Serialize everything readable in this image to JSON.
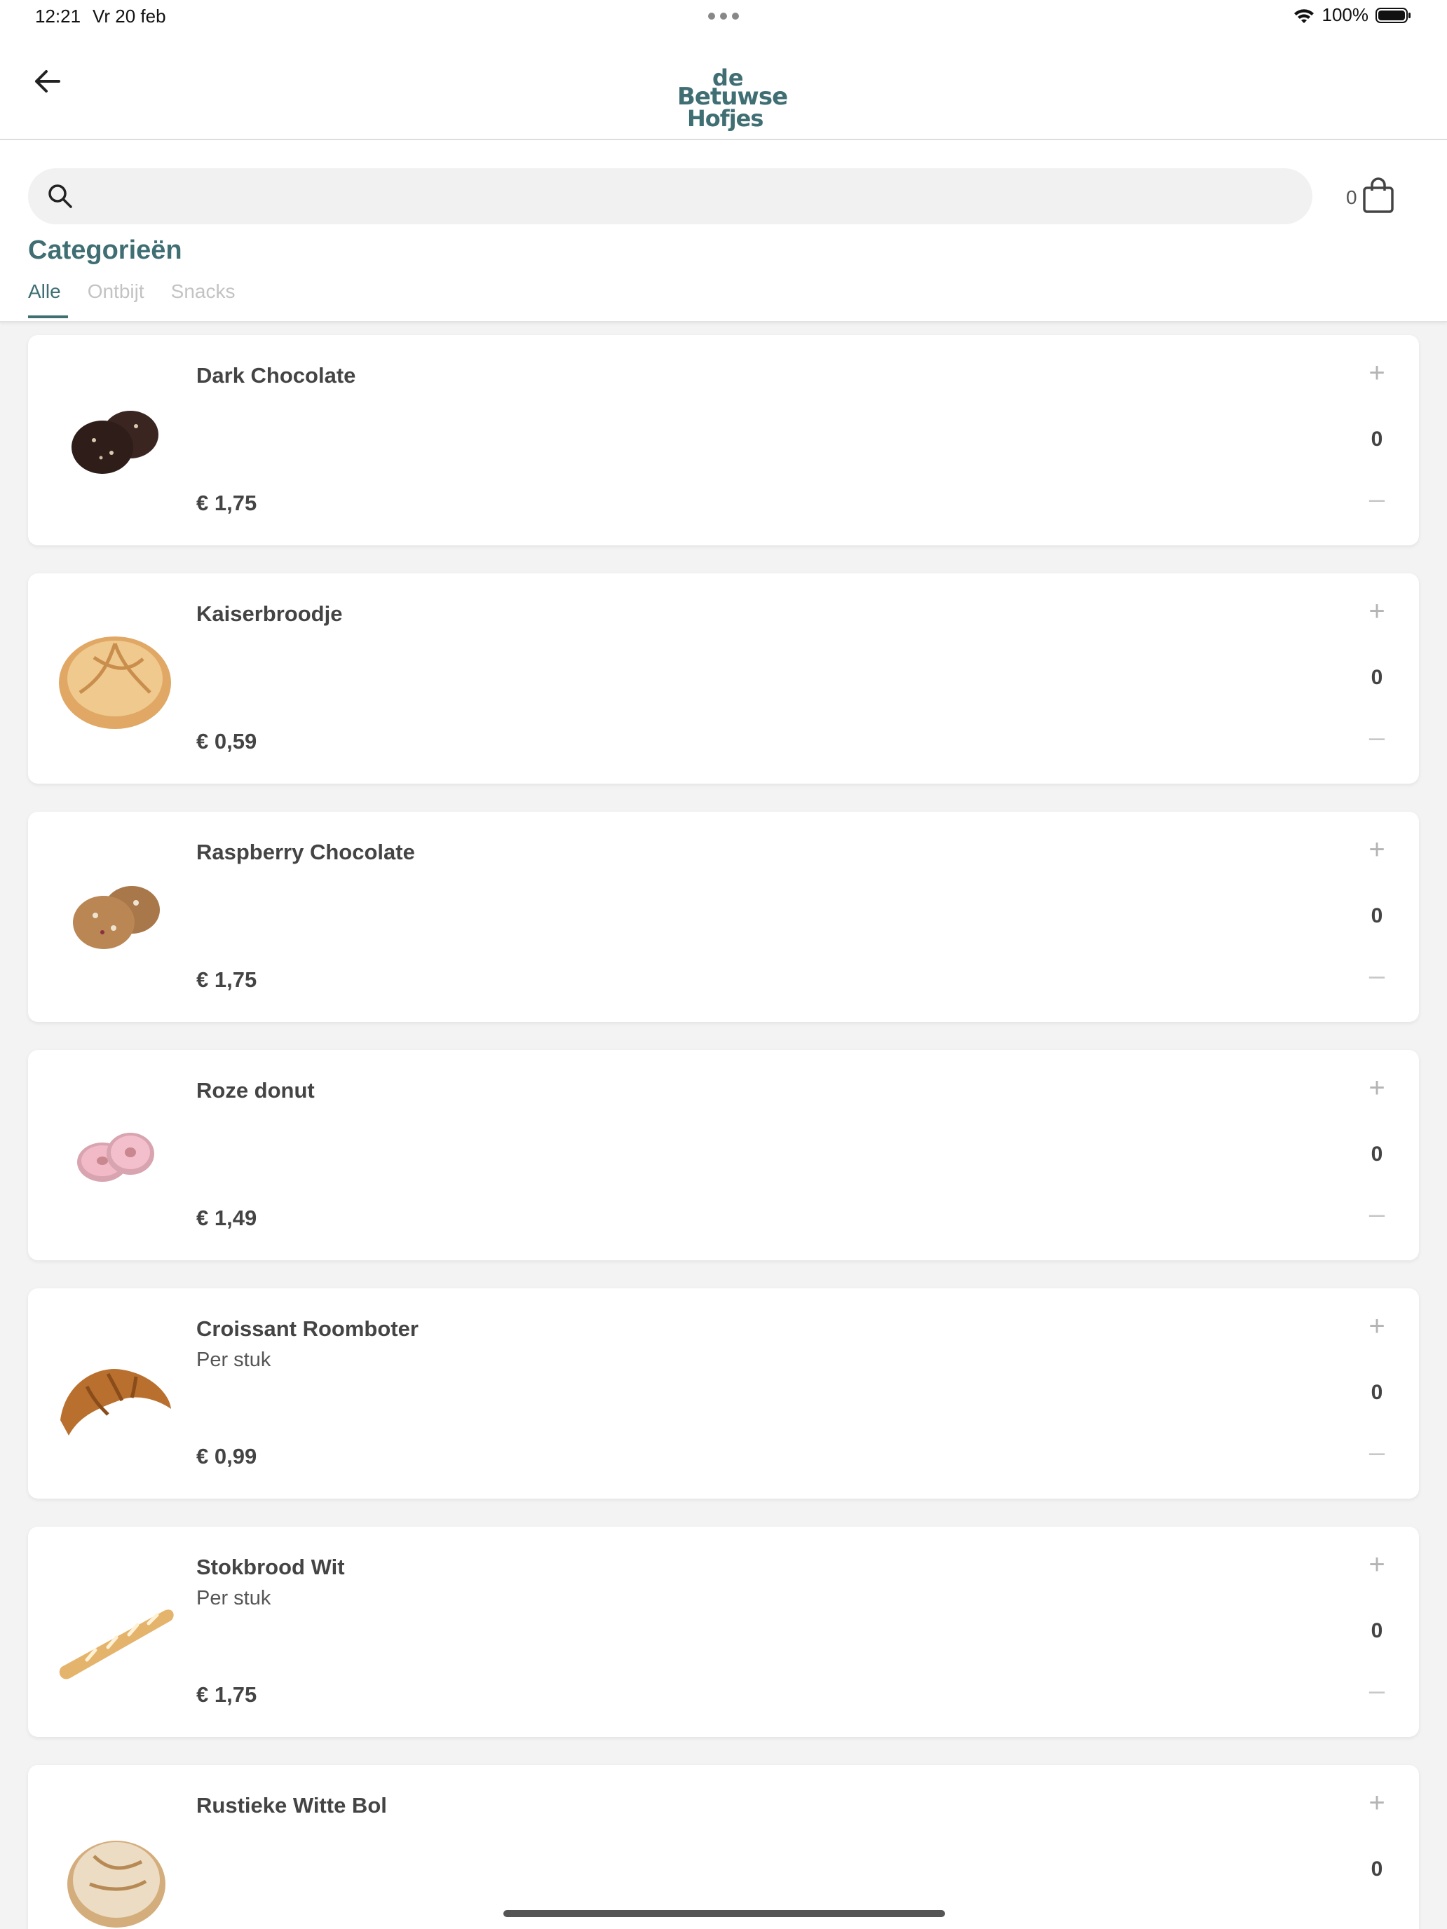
{
  "status_bar": {
    "time": "12:21",
    "date": "Vr 20 feb",
    "battery": "100%"
  },
  "header": {
    "logo_line1": "de",
    "logo_line2": "Betuwse",
    "logo_line3": "Hofjes",
    "brand_color": "#3f6e73"
  },
  "search": {
    "placeholder": "",
    "value": ""
  },
  "cart": {
    "count": "0"
  },
  "categories": {
    "title": "Categorieën",
    "tabs": [
      {
        "label": "Alle",
        "active": true
      },
      {
        "label": "Ontbijt",
        "active": false
      },
      {
        "label": "Snacks",
        "active": false
      }
    ]
  },
  "products": [
    {
      "name": "Dark Chocolate",
      "desc": "",
      "price": "€ 1,75",
      "qty": "0",
      "plus": "+",
      "minus": "–",
      "image": "dark-chocolate-cookies"
    },
    {
      "name": "Kaiserbroodje",
      "desc": "",
      "price": "€ 0,59",
      "qty": "0",
      "plus": "+",
      "minus": "–",
      "image": "kaiser-roll"
    },
    {
      "name": "Raspberry Chocolate",
      "desc": "",
      "price": "€ 1,75",
      "qty": "0",
      "plus": "+",
      "minus": "–",
      "image": "raspberry-cookies"
    },
    {
      "name": "Roze donut",
      "desc": "",
      "price": "€ 1,49",
      "qty": "0",
      "plus": "+",
      "minus": "–",
      "image": "pink-donuts"
    },
    {
      "name": "Croissant Roomboter",
      "desc": "Per stuk",
      "price": "€ 0,99",
      "qty": "0",
      "plus": "+",
      "minus": "–",
      "image": "croissant"
    },
    {
      "name": "Stokbrood Wit",
      "desc": "Per stuk",
      "price": "€ 1,75",
      "qty": "0",
      "plus": "+",
      "minus": "–",
      "image": "baguette"
    },
    {
      "name": "Rustieke Witte Bol",
      "desc": "",
      "price": "",
      "qty": "0",
      "plus": "+",
      "minus": "–",
      "image": "rustic-roll"
    }
  ]
}
